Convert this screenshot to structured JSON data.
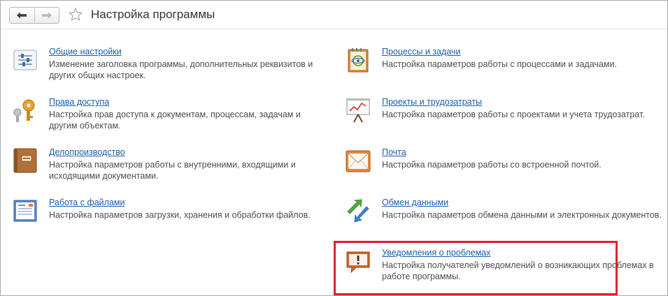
{
  "window": {
    "title": "Настройка программы"
  },
  "colors": {
    "link": "#1a5da8",
    "text": "#4d4d4d",
    "highlight": "#e0212b"
  },
  "sections": [
    {
      "id": "general",
      "icon": "sliders-icon",
      "title": "Общие настройки",
      "description": "Изменение заголовка программы, дополнительных реквизитов и других общих настроек."
    },
    {
      "id": "access",
      "icon": "keys-icon",
      "title": "Права доступа",
      "description": "Настройка прав доступа к документам, процессам, задачам и другим объектам."
    },
    {
      "id": "records",
      "icon": "folder-book-icon",
      "title": "Делопроизводство",
      "description": "Настройка параметров работы с внутренними, входящими и исходящими документами."
    },
    {
      "id": "files",
      "icon": "document-file-icon",
      "title": "Работа с файлами",
      "description": "Настройка параметров загрузки, хранения и обработки файлов."
    },
    {
      "id": "processes",
      "icon": "process-notebook-icon",
      "title": "Процессы и задачи",
      "description": "Настройка параметров работы с процессами и задачами."
    },
    {
      "id": "projects",
      "icon": "chart-easel-icon",
      "title": "Проекты и трудозатраты",
      "description": "Настройка параметров работы с проектами и учета трудозатрат."
    },
    {
      "id": "mail",
      "icon": "mail-envelope-icon",
      "title": "Почта",
      "description": "Настройка параметров работы со встроенной почтой."
    },
    {
      "id": "exchange",
      "icon": "exchange-arrows-icon",
      "title": "Обмен данными",
      "description": "Настройка параметров обмена данными и электронных документов."
    },
    {
      "id": "notifications",
      "icon": "alert-message-icon",
      "title": "Уведомления о проблемах",
      "description": "Настройка получателей уведомлений о возникающих проблемах в работе программы."
    }
  ]
}
